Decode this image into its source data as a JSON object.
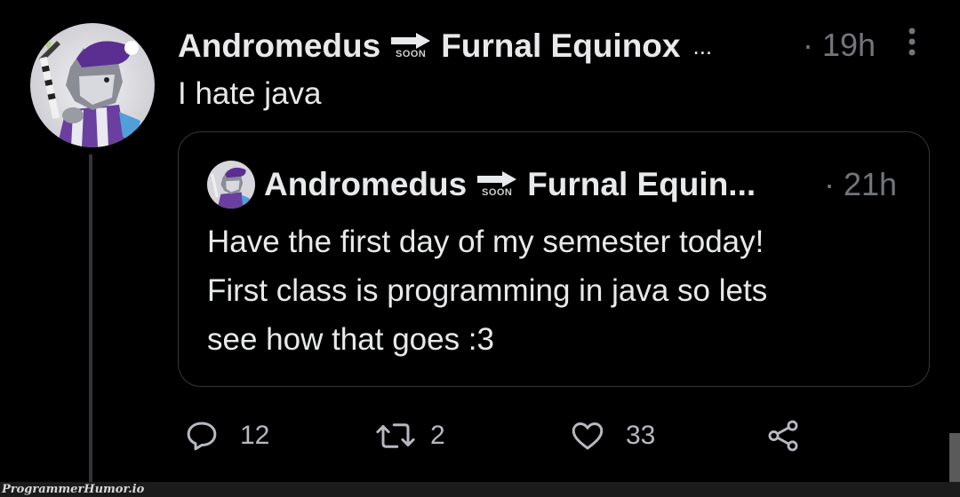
{
  "tweet": {
    "display_name_part1": "Andromedus",
    "soon_emoji_label": "SOON",
    "display_name_part2": "Furnal Equinox",
    "name_overflow": "...",
    "time": "· 19h",
    "text": "I hate java",
    "avatar_icon": "avatar-image"
  },
  "quote": {
    "display_name_part1": "Andromedus",
    "soon_emoji_label": "SOON",
    "display_name_part2": "Furnal Equin...",
    "time": "· 21h",
    "text_lines": [
      "Have the first day of my semester today!",
      "First class is programming in java so lets",
      "see how that goes :3"
    ]
  },
  "actions": {
    "reply_count": "12",
    "retweet_count": "2",
    "like_count": "33"
  },
  "watermark": "ProgrammerHumor.io",
  "colors": {
    "background": "#000000",
    "text": "#e7e9ea",
    "secondary": "#71767b",
    "border": "#333639"
  }
}
